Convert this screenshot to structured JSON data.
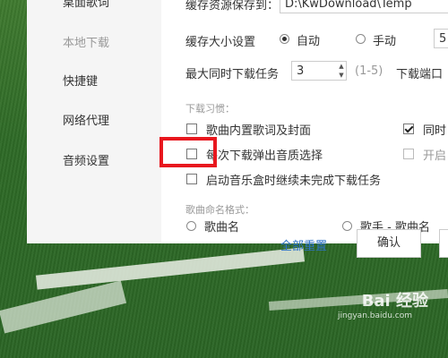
{
  "sidebar": {
    "items": [
      {
        "label": "桌面歌词",
        "state": "cut"
      },
      {
        "label": "本地下载",
        "state": "active"
      },
      {
        "label": "快捷键",
        "state": "normal"
      },
      {
        "label": "网络代理",
        "state": "normal"
      },
      {
        "label": "音频设置",
        "state": "normal"
      }
    ]
  },
  "cache": {
    "path_label": "缓存资源保存到：",
    "path_value": "D:\\KwDownload\\Temp",
    "size_label": "缓存大小设置",
    "auto_label": "自动",
    "manual_label": "手动",
    "manual_value": "5",
    "selected": "自动"
  },
  "download": {
    "max_label": "最大同时下载任务",
    "max_value": "3",
    "range": "(1-5)",
    "port_label": "下载端口"
  },
  "habits": {
    "section_title": "下载习惯：",
    "options": [
      {
        "label": "歌曲内置歌词及封面",
        "checked": false
      },
      {
        "label": "每次下载弹出音质选择",
        "checked": false
      },
      {
        "label": "启动音乐盒时继续未完成下载任务",
        "checked": false
      }
    ],
    "right_options": [
      {
        "label": "同时",
        "checked": true,
        "enabled": true
      },
      {
        "label": "开启",
        "checked": false,
        "enabled": false
      }
    ]
  },
  "naming": {
    "section_title": "歌曲命名格式：",
    "options": [
      "歌曲名",
      "歌手 - 歌曲名"
    ]
  },
  "footer": {
    "reset_label": "全部重置",
    "confirm_label": "确认"
  },
  "watermark": {
    "brand": "Bai 经验",
    "url": "jingyan.baidu.com"
  },
  "colors": {
    "highlight": "#e8171e",
    "link": "#2d73c8"
  }
}
